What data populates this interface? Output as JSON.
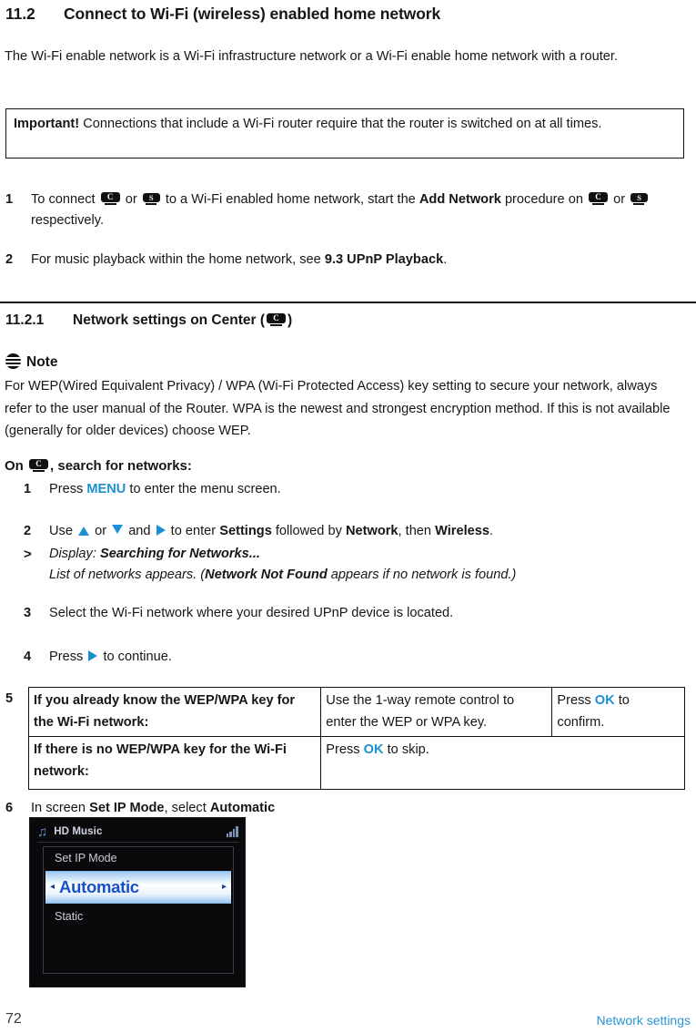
{
  "document": {
    "section_heading": {
      "number": "11.2",
      "title": "Connect to Wi-Fi (wireless) enabled home network"
    },
    "intro_paragraph": "The Wi-Fi enable network is a Wi-Fi infrastructure network or a Wi-Fi enable home network with a router.",
    "important_box": {
      "label": "Important!",
      "text": "Connections that include a Wi-Fi router require that the router is switched on at all times."
    },
    "steps_top": [
      {
        "marker": "1",
        "part1": "To connect",
        "icon_a": "C",
        "conj1": "or",
        "icon_b": "S",
        "part2": "to a Wi-Fi enabled home network, start the",
        "bold1": "Add Network",
        "part3": "procedure on",
        "icon_c": "C",
        "conj2": "or",
        "icon_d": "S",
        "part4": "respectively."
      },
      {
        "marker": "2",
        "part1": "For music playback within the home network, see",
        "bold1": "9.3 UPnP Playback",
        "part2": "."
      }
    ],
    "subsection_heading": {
      "number": "11.2.1",
      "title_before": "Network settings on Center (",
      "icon": "C",
      "title_after": ")"
    },
    "note": {
      "icon": "note-icon",
      "label": "Note",
      "text": "For WEP(Wired Equivalent Privacy) / WPA (Wi-Fi Protected Access) key setting to secure your network, always refer to the user manual of the Router. WPA is the newest and strongest encryption method. If this is not available (generally for older devices) choose WEP."
    },
    "on_line": {
      "prefix": "On",
      "icon": "C",
      "suffix": ", search for networks:"
    },
    "steps": [
      {
        "marker": "1",
        "part1": "Press",
        "accent1": "MENU",
        "part2": "to enter the menu screen."
      },
      {
        "marker": "2",
        "part1": "Use",
        "icon_up": "triangle-up-icon",
        "conj1": "or",
        "icon_down": "triangle-down-icon",
        "conj2": "and",
        "icon_right": "triangle-right-icon",
        "part2": "to enter",
        "bold1": "Settings",
        "part3": "followed by",
        "bold2": "Network",
        "part4": ", then",
        "bold3": "Wireless",
        "part5": "."
      },
      {
        "marker": ">",
        "display_label": "Display:",
        "display_value": "Searching for Networks...",
        "sub_before": "List of networks appears. (",
        "sub_bold": "Network Not Found",
        "sub_after": " appears if no network is found.)"
      },
      {
        "marker": "3",
        "part1": "Select the Wi-Fi network where your desired UPnP device is located."
      },
      {
        "marker": "4",
        "part1": "Press",
        "icon_right": "triangle-right-icon",
        "part2": "to continue."
      }
    ],
    "step5": {
      "marker": "5",
      "rows": [
        {
          "condition": "If you already know the WEP/WPA key for the Wi-Fi network:",
          "action": "Use the 1-way remote control to enter the WEP or WPA key.",
          "result_before": "Press",
          "result_accent": "OK",
          "result_after": "to confirm."
        },
        {
          "condition": "If there is no WEP/WPA key for the Wi-Fi network:",
          "action_before": "Press",
          "action_accent": "OK",
          "action_after": "to skip."
        }
      ]
    },
    "step6": {
      "marker": "6",
      "part1": "In screen",
      "bold1": "Set IP Mode",
      "part2": ", select",
      "bold2": "Automatic"
    },
    "device_screen": {
      "music_icon": "music-note-icon",
      "title": "HD Music",
      "signal_icon": "signal-bars-icon",
      "menu_label": "Set IP Mode",
      "selected_value": "Automatic",
      "left_arrow": "◂",
      "right_arrow": "▸",
      "other_option": "Static"
    },
    "footer": {
      "page_number": "72",
      "section_label": "Network settings"
    },
    "colors": {
      "accent_blue": "#1c90d4",
      "footer_blue": "#2a94d8",
      "text_black": "#161616",
      "screen_background": "#0a0a0c",
      "screen_value_blue": "#1750c8"
    }
  }
}
